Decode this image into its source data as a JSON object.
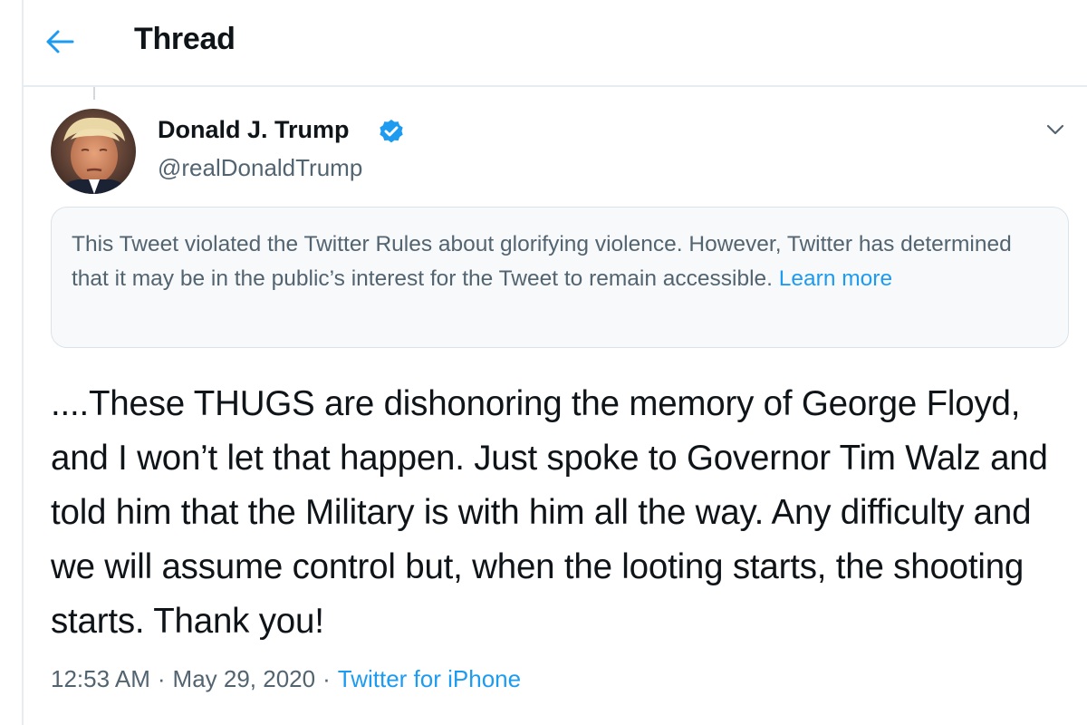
{
  "colors": {
    "accent": "#1d9bf0",
    "text_primary": "#0f1419",
    "text_secondary": "#536471",
    "notice_background": "#f7f9fa",
    "divider": "#e6ecf0"
  },
  "header": {
    "back_icon": "arrow-left-icon",
    "title": "Thread"
  },
  "tweet": {
    "author": {
      "name": "Donald J. Trump",
      "handle": "@realDonaldTrump",
      "verified": true,
      "verified_icon": "verified-badge-icon",
      "avatar_icon": "avatar-photo"
    },
    "more_icon": "chevron-down-icon",
    "notice": {
      "text": "This Tweet violated the Twitter Rules about glorifying violence. However, Twitter has determined that it may be in the public’s interest for the Tweet to remain accessible.",
      "link_label": "Learn more"
    },
    "text": "....These THUGS are dishonoring the memory of George Floyd, and I won’t let that happen. Just spoke to Governor Tim Walz and told him that the Military is with him all the way. Any difficulty and we will assume control but, when the looting starts, the shooting starts. Thank you!",
    "meta": {
      "time": "12:53 AM",
      "separator": "·",
      "date": "May 29, 2020",
      "source": "Twitter for iPhone"
    }
  }
}
